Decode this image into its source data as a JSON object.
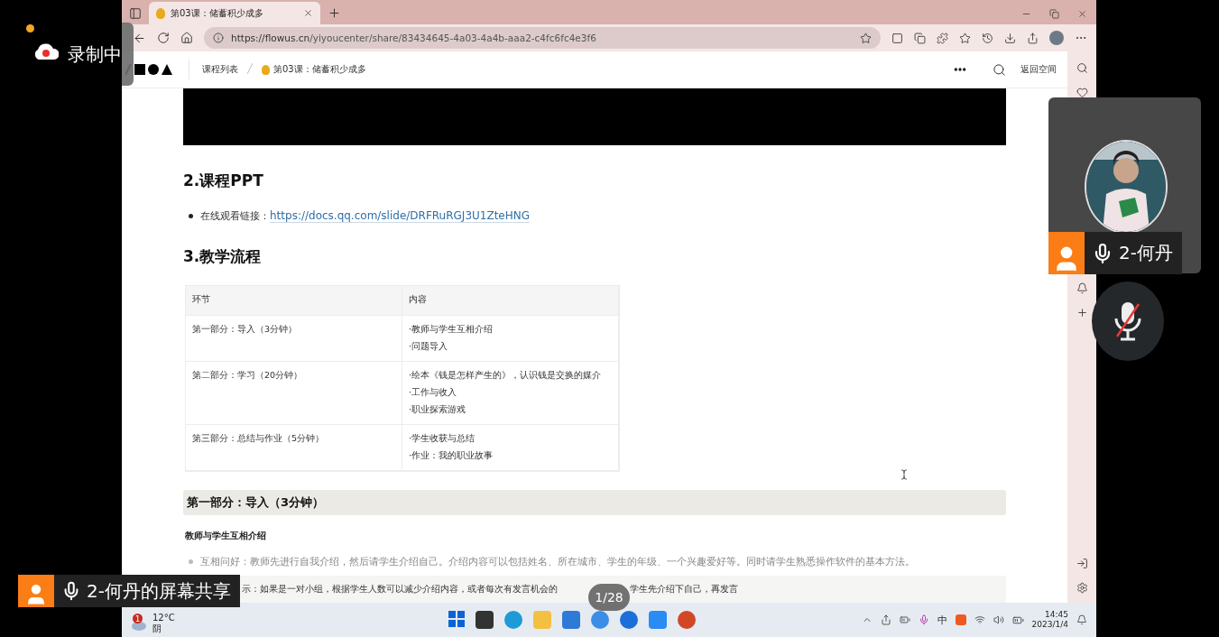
{
  "recording": {
    "label": "录制中"
  },
  "browser": {
    "tabs": [
      {
        "title": "第03课：储蓄积少成多",
        "selected": true
      }
    ],
    "url_host": "https://flowus.cn",
    "url_path": "/yiyoucenter/share/83434645-4a03-4a4b-aaa2-c4fc6fc4e3f6"
  },
  "page_header": {
    "breadcrumb": [
      {
        "label": "课程列表"
      },
      {
        "label": "第03课：储蓄积少成多"
      }
    ],
    "back_link": "返回空间"
  },
  "ppt_section": {
    "heading": "2.课程PPT",
    "item_label": "在线观看链接：",
    "link": "https://docs.qq.com/slide/DRFRuRGJ3U1ZteHNG"
  },
  "flow_section": {
    "heading": "3.教学流程"
  },
  "table": {
    "columns": [
      "环节",
      "内容"
    ],
    "rows": [
      {
        "stage": "第一部分：导入（3分钟）",
        "items": [
          "·教师与学生互相介绍",
          "·问题导入"
        ]
      },
      {
        "stage": "第二部分：学习（20分钟）",
        "items": [
          "·绘本《钱是怎样产生的》，认识钱是交换的媒介",
          "·工作与收入",
          "·职业探索游戏"
        ]
      },
      {
        "stage": "第三部分：总结与作业（5分钟）",
        "items": [
          "·学生收获与总结",
          "·作业：我的职业故事"
        ]
      }
    ]
  },
  "part_section": {
    "heading": "第一部分：导入（3分钟）",
    "subheading": "教师与学生互相介绍",
    "bullets": [
      "互相问好：教师先进行自我介绍，然后请学生介绍自己。介绍内容可以包括姓名、所在城市、学生的年级、一个兴趣爱好等。同时请学生熟悉操作软件的基本方法。"
    ],
    "callout_parts": [
      "示：如果是一对小组，根据学生人数可以减少介绍内容，或者每次有发言机会的",
      "学生先介绍下自己，再发言"
    ]
  },
  "participant": {
    "name": "2-何丹",
    "mic_muted": true
  },
  "screen_share": {
    "label": "2-何丹的屏幕共享",
    "page_counter": "1/28"
  },
  "taskbar": {
    "weather": {
      "badge": "1",
      "temperature": "12°C",
      "condition": "阴"
    },
    "ime": "中",
    "time": "14:45",
    "date": "2023/1/4"
  }
}
